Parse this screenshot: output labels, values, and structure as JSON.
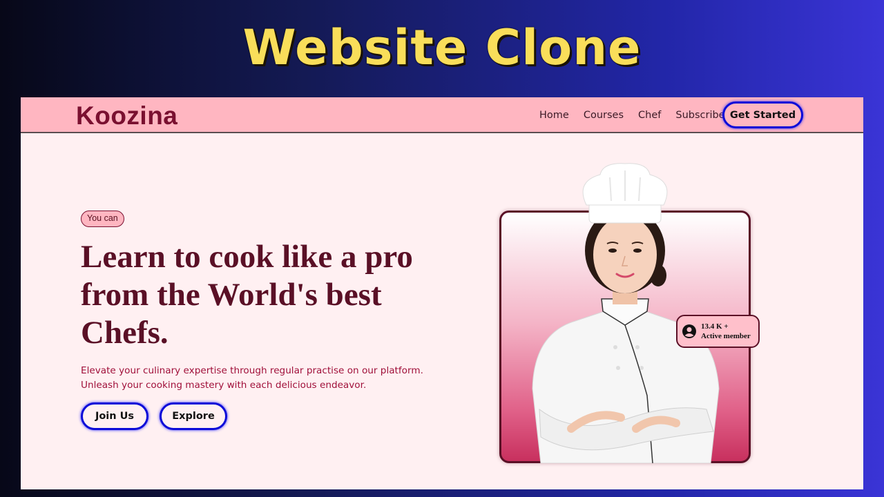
{
  "banner": {
    "title": "Website Clone"
  },
  "navbar": {
    "logo": "Koozina",
    "links": [
      "Home",
      "Courses",
      "Chef",
      "Subscribe"
    ],
    "cta_label": "Get Started"
  },
  "hero": {
    "badge": "You can",
    "headline": "Learn to cook like a pro from the World's best Chefs.",
    "description_lines": [
      "Elevate your culinary expertise through regular practise on our platform.",
      "Unleash your cooking mastery with each delicious endeavor."
    ],
    "buttons": {
      "join_label": "Join Us",
      "explore_label": "Explore"
    },
    "member_card": {
      "count": "13.4 K +",
      "label": "Active member",
      "icon": "user-circle-icon"
    }
  },
  "colors": {
    "navbar_bg": "#ffb6c1",
    "page_bg": "#fff0f2",
    "brand": "#7a1030",
    "headline": "#5a1026",
    "description": "#a0103a",
    "button_border": "#0b0bd8",
    "banner_title": "#f9de5a"
  }
}
